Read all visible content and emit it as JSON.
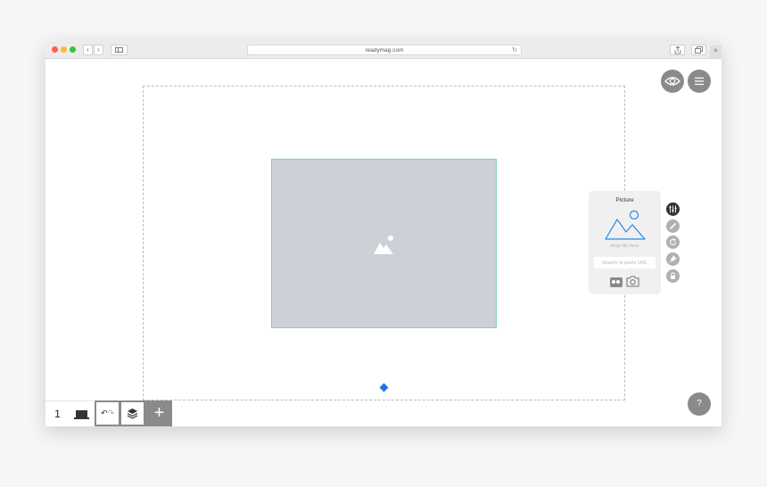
{
  "browser": {
    "url": "readymag.com",
    "reload_icon": "↻",
    "back_icon": "‹",
    "forward_icon": "›",
    "new_tab_icon": "+"
  },
  "panel": {
    "title": "Picture",
    "drop_text": "drop file here",
    "url_placeholder": "Search or paste URL"
  },
  "toolbar": {
    "page_number": "1",
    "undo_icon": "↶",
    "redo_icon": "↷",
    "add_icon": "+",
    "help_label": "?"
  },
  "colors": {
    "accent": "#1a73e8",
    "picture_fill": "#ccd0d7",
    "picture_border": "#7fd0c3",
    "control_gray": "#8a8a8a"
  }
}
